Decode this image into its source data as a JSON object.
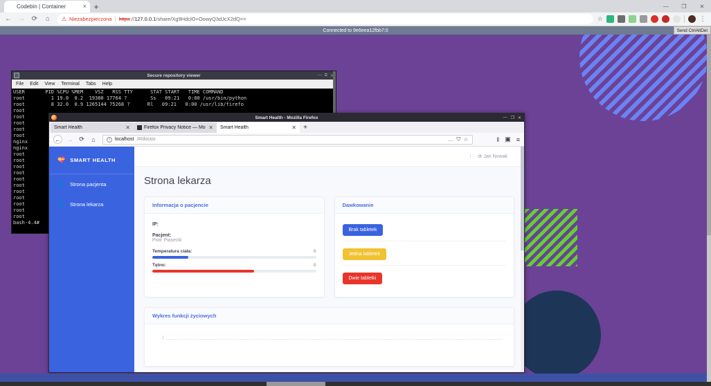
{
  "chrome": {
    "tab": {
      "title": "Codebin | Container",
      "favicon": "leaf-icon",
      "close": "×"
    },
    "newtab": "+",
    "window_controls": {
      "minimize": "—",
      "maximize": "❐",
      "close": "✕"
    },
    "toolbar": {
      "back": "←",
      "forward": "→",
      "reload": "⟳",
      "home": "⌂",
      "warning_icon": "⚠",
      "security_label": "Niezabezpieczona",
      "url_scheme": "https",
      "url_sep": "://",
      "url_host": "127.0.0.1",
      "url_path": "/share/Xg9HdclO+OowyQ3dJcX2dQ==",
      "bookmark_star": "☆",
      "kebab": "⋮"
    }
  },
  "vnc": {
    "status": "Connected to 9e6eea12fbb7:0",
    "send_keys_button": "Send CtrlAltDel"
  },
  "terminal": {
    "title": "Secure repository viewer",
    "icon": "terminal-icon",
    "window_controls": {
      "minimize": "—",
      "maximize": "⧉",
      "close": "✕"
    },
    "menu": [
      "File",
      "Edit",
      "View",
      "Terminal",
      "Tabs",
      "Help"
    ],
    "output": "USER       PID %CPU %MEM    VSZ   RSS TTY      STAT START   TIME COMMAND\nroot         1 19.0  0.2  19380 17764 ?        Ss   09:21   0:00 /usr/bin/python\nroot         8 32.0  0.9 1265144 75268 ?      Rl   09:21   0:00 /usr/lib/firefo\nroot\nroot\nroot\nroot\nroot\nnginx\nnginx\nroot\nroot\nroot\nroot\nroot\nroot\nroot\nroot\nroot\nroot\nroot\nbash-4.4# "
  },
  "firefox": {
    "title": "Smart Health - Mozilla Firefox",
    "window_controls": {
      "minimize": "—",
      "restore": "❐",
      "close": "✕"
    },
    "tabs": [
      {
        "label": "Smart Health",
        "favicon": "none",
        "close": "✕",
        "active": false
      },
      {
        "label": "Firefox Privacy Notice — Mo",
        "favicon": "doc-icon",
        "close": "✕",
        "active": false
      },
      {
        "label": "Smart Health",
        "favicon": "none",
        "close": "✕",
        "active": true
      }
    ],
    "newtab": "+",
    "nav": {
      "back": "←",
      "forward": "→",
      "reload": "⟳",
      "home": "⌂",
      "info_icon": "ⓘ",
      "url_host": "localhost",
      "url_path": "/#/doctor",
      "page_actions": "…",
      "shield": "⛉",
      "star": "☆",
      "library": "‖",
      "sidebar": "▣",
      "menu": "≡"
    }
  },
  "app": {
    "brand": {
      "name": "SMART HEALTH",
      "icon": "heart-pulse-icon"
    },
    "sidebar_items": [
      {
        "label": "Strona pacjenta",
        "icon": "user-icon"
      },
      {
        "label": "Strona lekarza",
        "icon": "user-md-icon"
      }
    ],
    "topbar": {
      "user": "dr Jan Nowak"
    },
    "page_title": "Strona lekarza",
    "patient_card": {
      "heading": "Informacja o pacjencie",
      "ip_label": "IP:",
      "ip_value": "",
      "patient_label": "Pacjent:",
      "patient_value": "Piotr Piasecki",
      "metrics": [
        {
          "label": "Temperatura ciała:",
          "value": "0",
          "percent": 22,
          "color": "#3a63e0"
        },
        {
          "label": "Tętno:",
          "value": "0",
          "percent": 62,
          "color": "#e8352b"
        }
      ]
    },
    "dose_card": {
      "heading": "Dawkowanie",
      "buttons": [
        {
          "label": "Brak tabletek",
          "color": "#3a63e0"
        },
        {
          "label": "Jedna tabletek",
          "color": "#f1c232"
        },
        {
          "label": "Dwie tabletki",
          "color": "#e8352b"
        }
      ]
    },
    "chart_card": {
      "heading": "Wykres funkcji życiowych"
    }
  }
}
